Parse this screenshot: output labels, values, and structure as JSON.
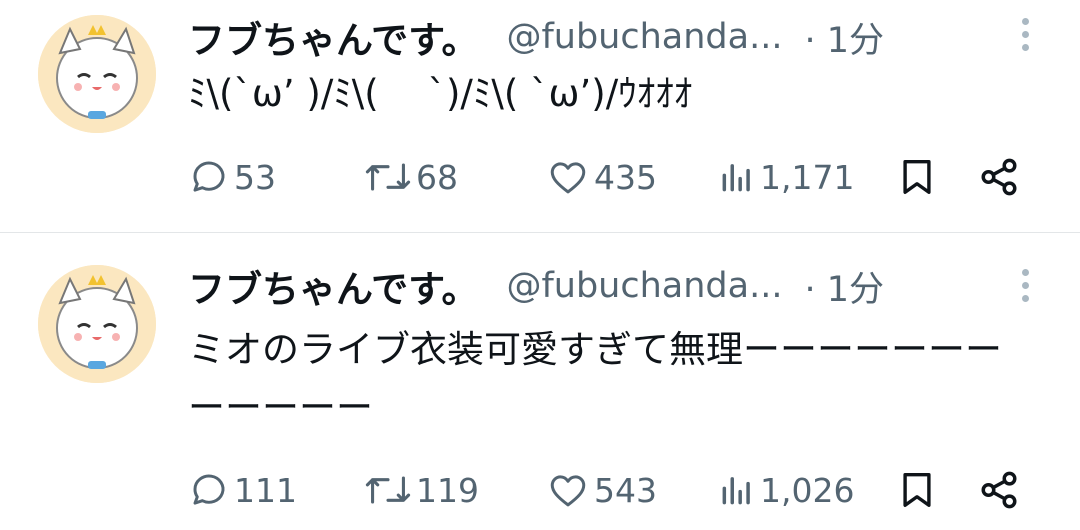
{
  "tweets": [
    {
      "name": "フブちゃんです。",
      "handle": "@fubuchanda...",
      "time": "· 1分",
      "text": "ﾐ\\(`ω’ )/ﾐ\\(　 `)/ﾐ\\( `ω’)/ｳｵｵｵ",
      "replies": "53",
      "retweets": "68",
      "likes": "435",
      "views": "1,171"
    },
    {
      "name": "フブちゃんです。",
      "handle": "@fubuchanda...",
      "time": "· 1分",
      "text": "ミオのライブ衣装可愛すぎて無理ーーーーーーーーーーーー",
      "replies": "111",
      "retweets": "119",
      "likes": "543",
      "views": "1,026"
    }
  ],
  "icons": {
    "reply": "speech-bubble-icon",
    "retweet": "retweet-icon",
    "like": "heart-icon",
    "views": "bar-chart-icon",
    "bookmark": "bookmark-icon",
    "share": "share-icon",
    "more": "vertical-dots-icon"
  },
  "colors": {
    "secondary_text": "#536471",
    "divider": "#e3e6e8"
  }
}
